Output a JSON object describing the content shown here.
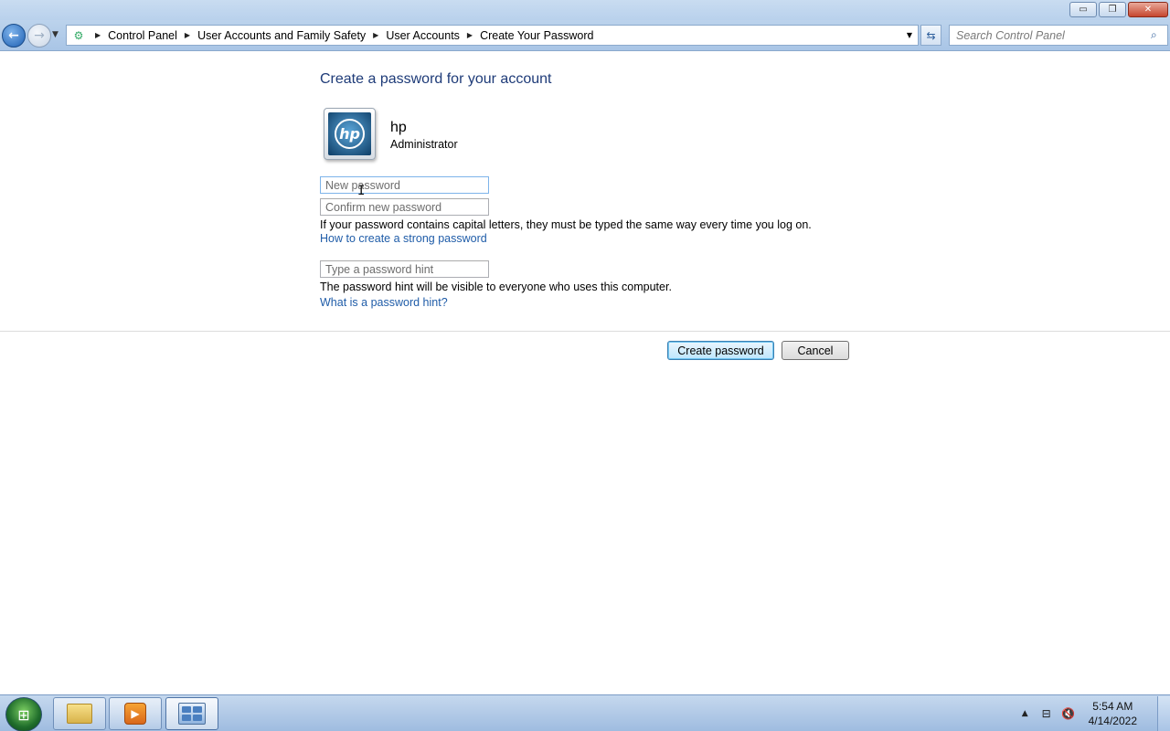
{
  "window": {
    "minimize_glyph": "▭",
    "restore_glyph": "❐",
    "close_glyph": "✕"
  },
  "nav": {
    "breadcrumbs": [
      "Control Panel",
      "User Accounts and Family Safety",
      "User Accounts",
      "Create Your Password"
    ],
    "search_placeholder": "Search Control Panel"
  },
  "page": {
    "heading": "Create a password for your account",
    "user": {
      "name": "hp",
      "role": "Administrator",
      "avatar_logo": "hp"
    },
    "fields": {
      "new_password_placeholder": "New password",
      "confirm_password_placeholder": "Confirm new password",
      "hint_placeholder": "Type a password hint"
    },
    "capital_letters_note": "If your password contains capital letters, they must be typed the same way every time you log on.",
    "strong_password_link": "How to create a strong password",
    "hint_note": "The password hint will be visible to everyone who uses this computer.",
    "hint_link": "What is a password hint?",
    "create_button": "Create password",
    "cancel_button": "Cancel"
  },
  "taskbar": {
    "time": "5:54 AM",
    "date": "4/14/2022",
    "items": [
      "file-explorer",
      "media-player",
      "control-panel"
    ]
  },
  "colors": {
    "heading": "#1e3b78",
    "link": "#1f5ca8",
    "accent": "#3c7fb1"
  }
}
